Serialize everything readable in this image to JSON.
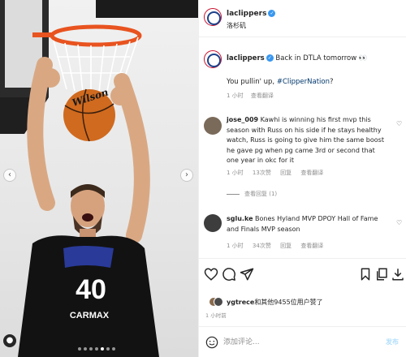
{
  "post": {
    "username": "laclippers",
    "location": "洛杉矶"
  },
  "caption": {
    "username": "laclippers",
    "text": "Back in DTLA tomorrow 👀",
    "line2_prefix": "You pullin' up, ",
    "hashtag": "#ClipperNation",
    "line2_suffix": "?",
    "time": "1 小时",
    "translate": "查看翻译"
  },
  "comments": [
    {
      "username": "jose_009",
      "text": "Kawhi is winning his first mvp this season with Russ on his side if he stays healthy watch, Russ is going to give him the same boost he gave pg when pg came 3rd or second that one year in okc for it",
      "time": "1 小时",
      "likes": "13次赞",
      "reply": "回复",
      "translate": "查看翻译",
      "replies": "查看回复 (1)"
    },
    {
      "username": "sglu.ke",
      "text": "Bones Hyland MVP DPOY Hall of Fame and Finals MVP season",
      "time": "1 小时",
      "likes": "34次赞",
      "reply": "回复",
      "translate": "查看翻译"
    }
  ],
  "likes": {
    "username": "ygtrece",
    "suffix": "和其他9455位用户赞了",
    "time": "1 小时前"
  },
  "add_comment": {
    "placeholder": "添加评论...",
    "post_label": "发布"
  },
  "photo": {
    "jersey_number": "40",
    "jersey_sponsor": "CARMAX",
    "ball_brand": "Wilson",
    "slide_count": 7,
    "active_slide": 4
  },
  "colors": {
    "link": "#00376b",
    "verified": "#3897f0",
    "muted": "#8e8e8e",
    "clippers_red": "#c8102e",
    "clippers_blue": "#1d428a"
  }
}
